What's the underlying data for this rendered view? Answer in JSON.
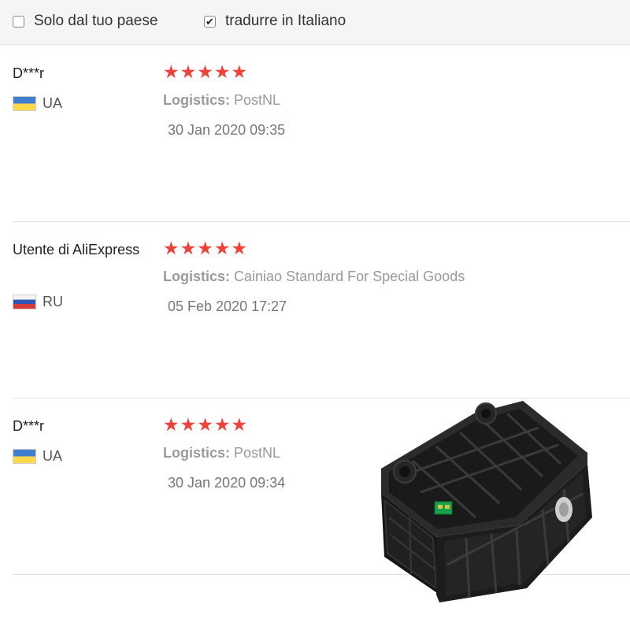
{
  "filters": [
    {
      "label": "Solo dal tuo paese",
      "checked": false
    },
    {
      "label": "tradurre in Italiano",
      "checked": true
    }
  ],
  "logistics_label": "Logistics:",
  "star_icon": "★",
  "check_mark": "✔",
  "colors": {
    "star": "#ef4339",
    "text_muted": "#999999"
  },
  "reviews": [
    {
      "name": "D***r",
      "country": "UA",
      "flag": "ukraine-flag",
      "rating": 5,
      "logistics": "PostNL",
      "date": "30 Jan 2020 09:35"
    },
    {
      "name": "Utente di AliExpress",
      "country": "RU",
      "flag": "russia-flag",
      "rating": 5,
      "logistics": "Cainiao Standard For Special Goods",
      "date": "05 Feb 2020 17:27"
    },
    {
      "name": "D***r",
      "country": "UA",
      "flag": "ukraine-flag",
      "rating": 5,
      "logistics": "PostNL",
      "date": "30 Jan 2020 09:34"
    }
  ]
}
